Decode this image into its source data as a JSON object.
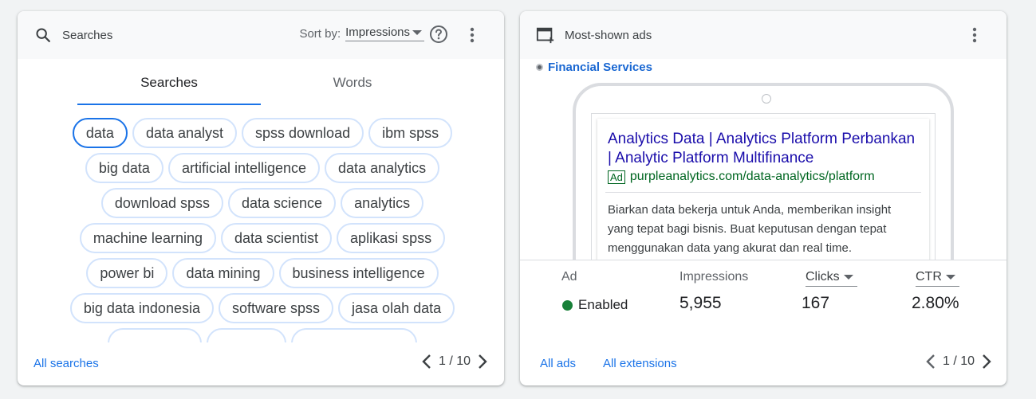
{
  "searches_card": {
    "title": "Searches",
    "sort_by_label": "Sort by:",
    "sort_by_value": "Impressions",
    "tabs": [
      {
        "label": "Searches",
        "selected": true
      },
      {
        "label": "Words",
        "selected": false
      }
    ],
    "chip_rows": [
      [
        "data",
        "data analyst",
        "spss download",
        "ibm spss"
      ],
      [
        "big data",
        "artificial intelligence",
        "data analytics"
      ],
      [
        "download spss",
        "data science",
        "analytics"
      ],
      [
        "machine learning",
        "data scientist",
        "aplikasi spss"
      ],
      [
        "power bi",
        "data mining",
        "business intelligence"
      ],
      [
        "big data indonesia",
        "software spss",
        "jasa olah data"
      ]
    ],
    "selected_chip": "data",
    "footer_link": "All searches",
    "pager": "1 / 10"
  },
  "ads_card": {
    "title": "Most-shown ads",
    "category": "Financial Services",
    "ad": {
      "headline": "Analytics Data | Analytics Platform Perbankan | Analytic Platform Multifinance",
      "badge": "Ad",
      "url": "purpleanalytics.com/data-analytics/platform",
      "description": "Biarkan data bekerja untuk Anda, memberikan insight yang tepat bagi bisnis. Buat keputusan dengan tepat menggunakan data yang akurat dan real time."
    },
    "stats": {
      "ad_label": "Ad",
      "status": "Enabled",
      "impressions_label": "Impressions",
      "impressions_value": "5,955",
      "clicks_label": "Clicks",
      "clicks_value": "167",
      "ctr_label": "CTR",
      "ctr_value": "2.80%"
    },
    "footer_links": [
      "All ads",
      "All extensions"
    ],
    "pager": "1 / 10"
  },
  "colors": {
    "accent": "#1a73e8",
    "chip_border": "#d2e3fc",
    "ad_headline": "#1a0dab",
    "ad_url": "#006621",
    "status_green": "#188038"
  },
  "icons": [
    "search-icon",
    "help-icon",
    "more-vert-icon",
    "ad-window-icon",
    "chevron-left-icon",
    "chevron-right-icon",
    "arrow-drop-down-icon"
  ]
}
